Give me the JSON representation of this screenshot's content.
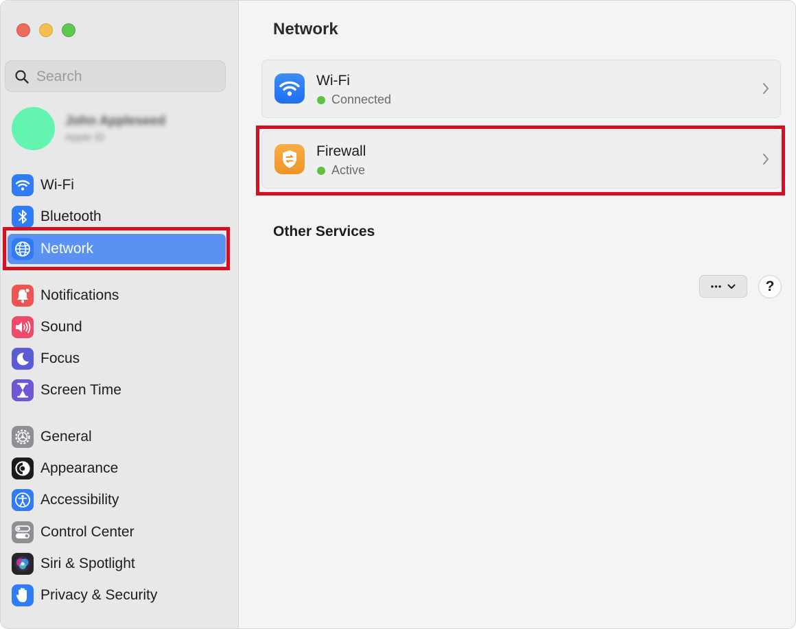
{
  "window": {
    "traffic_lights": [
      "close",
      "minimize",
      "zoom"
    ]
  },
  "sidebar": {
    "search": {
      "placeholder": "Search",
      "value": ""
    },
    "account": {
      "name": "John Appleseed",
      "subtitle": "Apple ID"
    },
    "groups": [
      [
        {
          "label": "Wi-Fi",
          "icon": "wifi-icon",
          "color": "#2f7cf6"
        },
        {
          "label": "Bluetooth",
          "icon": "bluetooth-icon",
          "color": "#2f7cf6"
        },
        {
          "label": "Network",
          "icon": "globe-icon",
          "color": "#2f7cf6",
          "selected": true
        }
      ],
      [
        {
          "label": "Notifications",
          "icon": "bell-icon",
          "color": "#ee5450"
        },
        {
          "label": "Sound",
          "icon": "speaker-icon",
          "color": "#ef4a6a"
        },
        {
          "label": "Focus",
          "icon": "moon-icon",
          "color": "#5b5bd6"
        },
        {
          "label": "Screen Time",
          "icon": "hourglass-icon",
          "color": "#6e56d6"
        }
      ],
      [
        {
          "label": "General",
          "icon": "gear-icon",
          "color": "#8e8e93"
        },
        {
          "label": "Appearance",
          "icon": "appearance-icon",
          "color": "#1c1c1e"
        },
        {
          "label": "Accessibility",
          "icon": "accessibility-icon",
          "color": "#2f7cf6"
        },
        {
          "label": "Control Center",
          "icon": "toggles-icon",
          "color": "#8e8e93"
        },
        {
          "label": "Siri & Spotlight",
          "icon": "siri-icon",
          "color": "#262626"
        },
        {
          "label": "Privacy & Security",
          "icon": "hand-icon",
          "color": "#2f7cf6"
        }
      ]
    ]
  },
  "main": {
    "title": "Network",
    "services": [
      {
        "name": "Wi-Fi",
        "status": "Connected",
        "icon": "wifi-icon",
        "status_color": "#5fc245"
      },
      {
        "name": "Firewall",
        "status": "Active",
        "icon": "firewall-shield-icon",
        "status_color": "#5fc245"
      }
    ],
    "other_services_title": "Other Services",
    "actions": {
      "more_label": "•••",
      "help_label": "?"
    }
  },
  "highlight_color": "#d50f1f"
}
